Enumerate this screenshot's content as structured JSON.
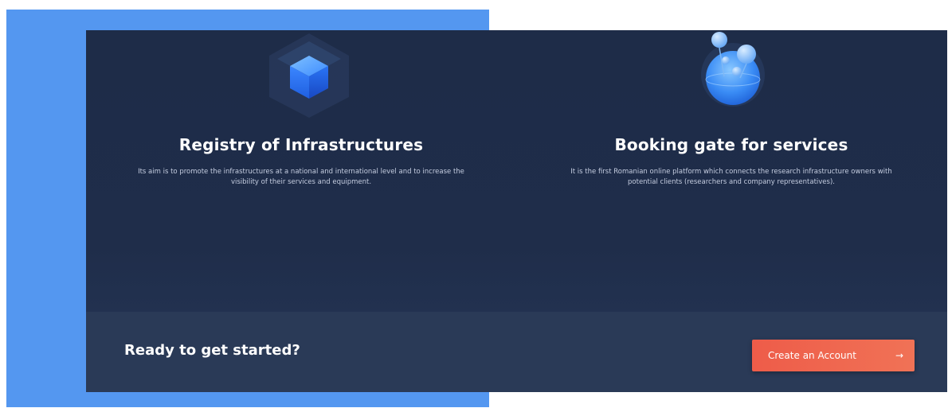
{
  "features": [
    {
      "icon": "cube-icon",
      "title": "Registry of Infrastructures",
      "description": "Its aim is to promote the infrastructures at a national and international level and to increase the visibility of their services and equipment."
    },
    {
      "icon": "globe-bubbles-icon",
      "title": "Booking gate for services",
      "description": "It is the first Romanian online platform which connects the research infrastructure owners with potential clients (researchers and company representatives)."
    }
  ],
  "cta": {
    "heading": "Ready to get started?",
    "button_label": "Create an Account",
    "button_icon": "arrow-right-icon"
  },
  "colors": {
    "accent_blue": "#5497f0",
    "panel_bg": "#1f2d4a",
    "cta_bar_bg": "#2a3a57",
    "button": "#ef6450"
  }
}
